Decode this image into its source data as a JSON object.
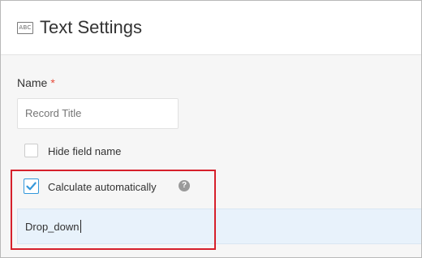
{
  "header": {
    "icon": "text-field-icon",
    "icon_text": "ABC",
    "title": "Text Settings"
  },
  "name_field": {
    "label": "Name",
    "required_marker": "*",
    "placeholder": "Record Title",
    "value": ""
  },
  "hide_field_name": {
    "label": "Hide field name",
    "checked": false
  },
  "calculate_automatically": {
    "label": "Calculate automatically",
    "checked": true,
    "help_icon": "question-circle-icon",
    "help_glyph": "?"
  },
  "formula": {
    "value": "Drop_down"
  },
  "colors": {
    "accent": "#3498db",
    "required": "#e74c3c",
    "highlight_box": "#d6202b",
    "formula_bg": "#e8f2fb"
  }
}
